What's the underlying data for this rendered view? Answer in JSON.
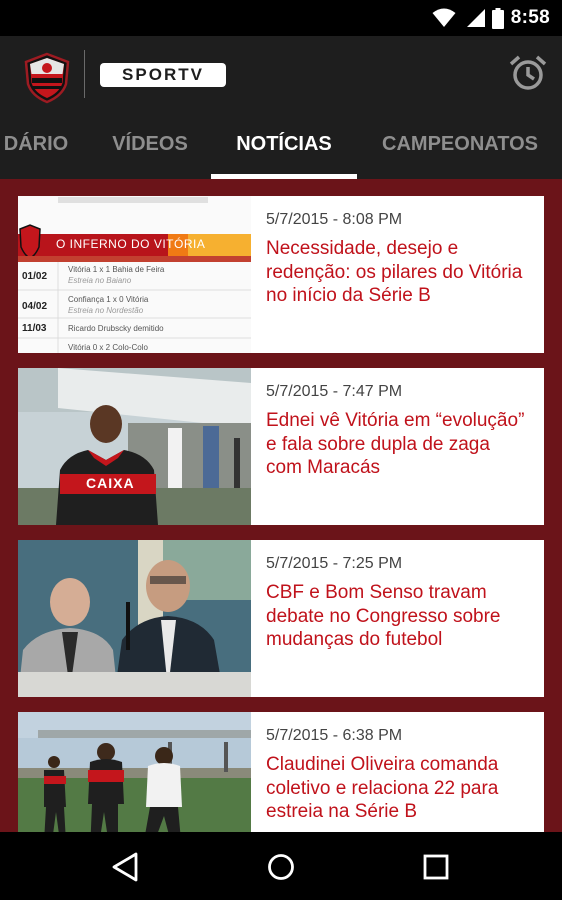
{
  "status_bar": {
    "time": "8:58"
  },
  "header": {
    "club_crest": "ecv-crest-icon",
    "sportv_logo": "SPORTV",
    "alarm": "alarm-clock-icon"
  },
  "tabs": [
    {
      "label": "DÁRIO",
      "active": false
    },
    {
      "label": "VÍDEOS",
      "active": false
    },
    {
      "label": "NOTÍCIAS",
      "active": true
    },
    {
      "label": "CAMPEONATOS",
      "active": false
    }
  ],
  "news": [
    {
      "date": "5/7/2015 - 8:08 PM",
      "headline": "Necessidade, desejo e redenção: os pilares do Vitória no início da Série B",
      "thumb": {
        "banner": "O INFERNO DO VITÓRIA",
        "rows": [
          {
            "date": "01/02",
            "text": "Vitória 1 x 1 Bahia de Feira",
            "sub": "Estreia no Baiano"
          },
          {
            "date": "04/02",
            "text": "Confiança 1 x 0 Vitória",
            "sub": "Estreia no Nordestão"
          },
          {
            "date": "11/03",
            "text": "Ricardo Drubscky demitido",
            "sub": ""
          },
          {
            "date": "",
            "text": "Vitória 0 x 2 Colo-Colo",
            "sub": ""
          }
        ]
      }
    },
    {
      "date": "5/7/2015 - 7:47 PM",
      "headline": "Ednei vê Vitória em “evolução” e fala sobre dupla de zaga com Maracás",
      "thumb": {
        "shirt": "CAIXA"
      }
    },
    {
      "date": "5/7/2015 - 7:25 PM",
      "headline": "CBF e Bom Senso travam debate no Congresso sobre mudanças do futebol",
      "thumb": {}
    },
    {
      "date": "5/7/2015 - 6:38 PM",
      "headline": "Claudinei Oliveira comanda coletivo e relaciona 22 para estreia na Série B",
      "thumb": {}
    }
  ],
  "colors": {
    "accent": "#c0121b",
    "background": "#6b1419",
    "appbar": "#1e1e1e"
  },
  "nav": {
    "back": "back-icon",
    "home": "home-icon",
    "recents": "recents-icon"
  }
}
